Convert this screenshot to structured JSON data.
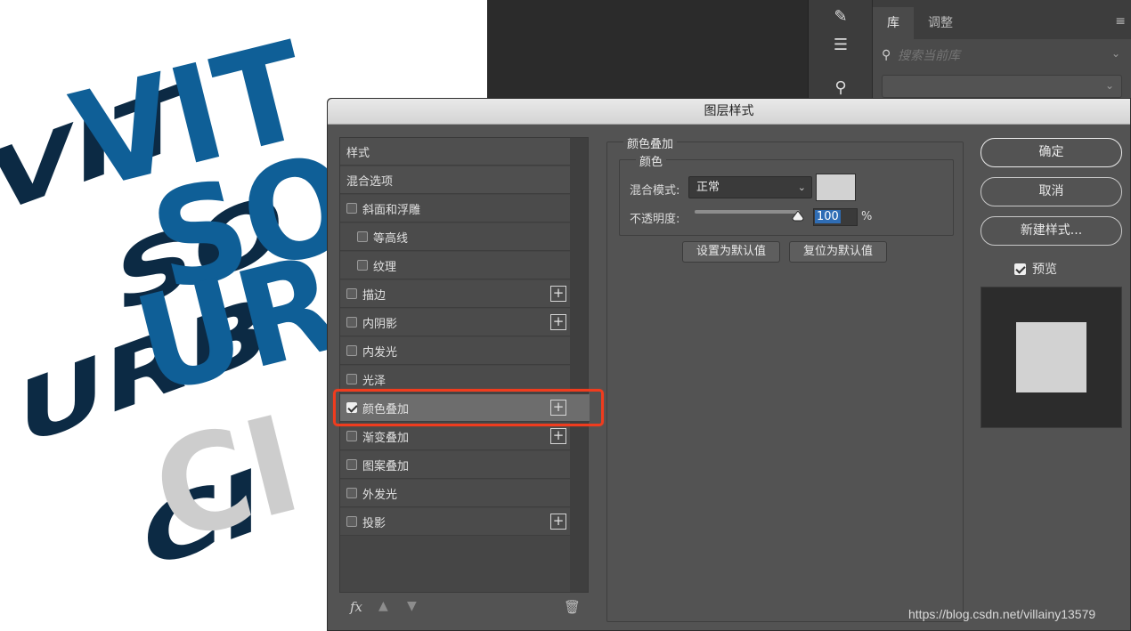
{
  "artwork": {
    "line1": "VIT",
    "line2": "SO",
    "line3": "URB",
    "line4": "CI"
  },
  "library_panel": {
    "tabs": [
      {
        "label": "库",
        "active": true
      },
      {
        "label": "调整",
        "active": false
      }
    ],
    "search_placeholder": "搜索当前库"
  },
  "dialog": {
    "title": "图层样式",
    "style_list": [
      {
        "label": "样式",
        "kind": "header"
      },
      {
        "label": "混合选项",
        "kind": "header"
      },
      {
        "label": "斜面和浮雕",
        "checked": false,
        "indent": false,
        "plus": false
      },
      {
        "label": "等高线",
        "checked": false,
        "indent": true,
        "plus": false
      },
      {
        "label": "纹理",
        "checked": false,
        "indent": true,
        "plus": false
      },
      {
        "label": "描边",
        "checked": false,
        "indent": false,
        "plus": true
      },
      {
        "label": "内阴影",
        "checked": false,
        "indent": false,
        "plus": true
      },
      {
        "label": "内发光",
        "checked": false,
        "indent": false,
        "plus": false
      },
      {
        "label": "光泽",
        "checked": false,
        "indent": false,
        "plus": false
      },
      {
        "label": "颜色叠加",
        "checked": true,
        "indent": false,
        "plus": true,
        "selected": true
      },
      {
        "label": "渐变叠加",
        "checked": false,
        "indent": false,
        "plus": true
      },
      {
        "label": "图案叠加",
        "checked": false,
        "indent": false,
        "plus": false
      },
      {
        "label": "外发光",
        "checked": false,
        "indent": false,
        "plus": false
      },
      {
        "label": "投影",
        "checked": false,
        "indent": false,
        "plus": true
      }
    ],
    "footer": {
      "fx": "fx"
    },
    "section_title": "颜色叠加",
    "group_title": "颜色",
    "blend_mode_label": "混合模式:",
    "blend_mode_value": "正常",
    "overlay_color": "#d2d2d2",
    "opacity_label": "不透明度:",
    "opacity_value": "100",
    "opacity_unit": "%",
    "opacity_fraction": 1.0,
    "set_default_label": "设置为默认值",
    "reset_default_label": "复位为默认值",
    "ok_label": "确定",
    "cancel_label": "取消",
    "new_style_label": "新建样式...",
    "preview_label": "预览",
    "preview_checked": true
  },
  "colors": {
    "highlight": "#f03c1e",
    "art_blue": "#0f5f97",
    "art_shadow": "#0c2a44",
    "art_grey": "#cdcdcd"
  },
  "watermark": "https://blog.csdn.net/villainy13579"
}
